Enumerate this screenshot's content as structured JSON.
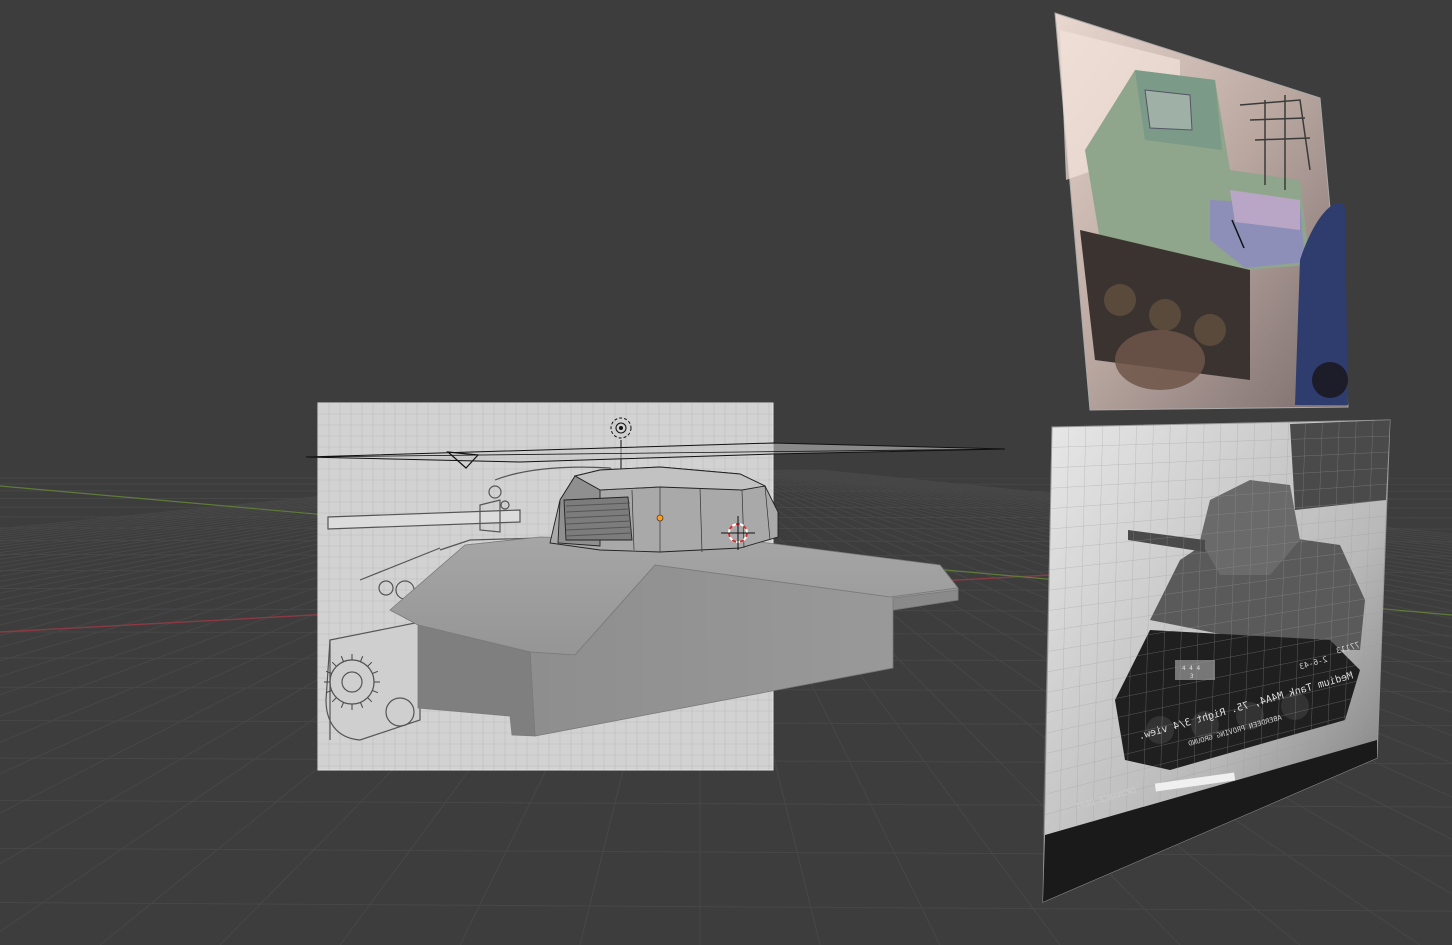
{
  "app": "3D viewport",
  "colors": {
    "background": "#3d3d3d",
    "x_axis": "#8a3a44",
    "y_axis": "#5f7a3a",
    "grid": "#474747",
    "origin": "#ff9d1e"
  },
  "objects": [
    {
      "name": "side blueprint reference plane",
      "kind": "image-plane"
    },
    {
      "name": "hull mesh",
      "kind": "mesh"
    },
    {
      "name": "turret mesh",
      "kind": "mesh"
    },
    {
      "name": "color photo reference plane",
      "kind": "image-plane"
    },
    {
      "name": "black and white photo reference plane",
      "kind": "image-plane"
    },
    {
      "name": "camera",
      "kind": "camera"
    },
    {
      "name": "light",
      "kind": "light"
    },
    {
      "name": "3d cursor",
      "kind": "cursor"
    }
  ],
  "photo_bw": {
    "caption_line1": "Medium Tank M4A4, 75. Right 3/4 view.",
    "caption_line2": "ABERDEEN PROVING GROUND",
    "caption_line3": "ORDNANCE DEPT",
    "neg_number": "77113",
    "date": "2-6-43",
    "hull_code": "4 4 4",
    "turret_number": "3"
  }
}
